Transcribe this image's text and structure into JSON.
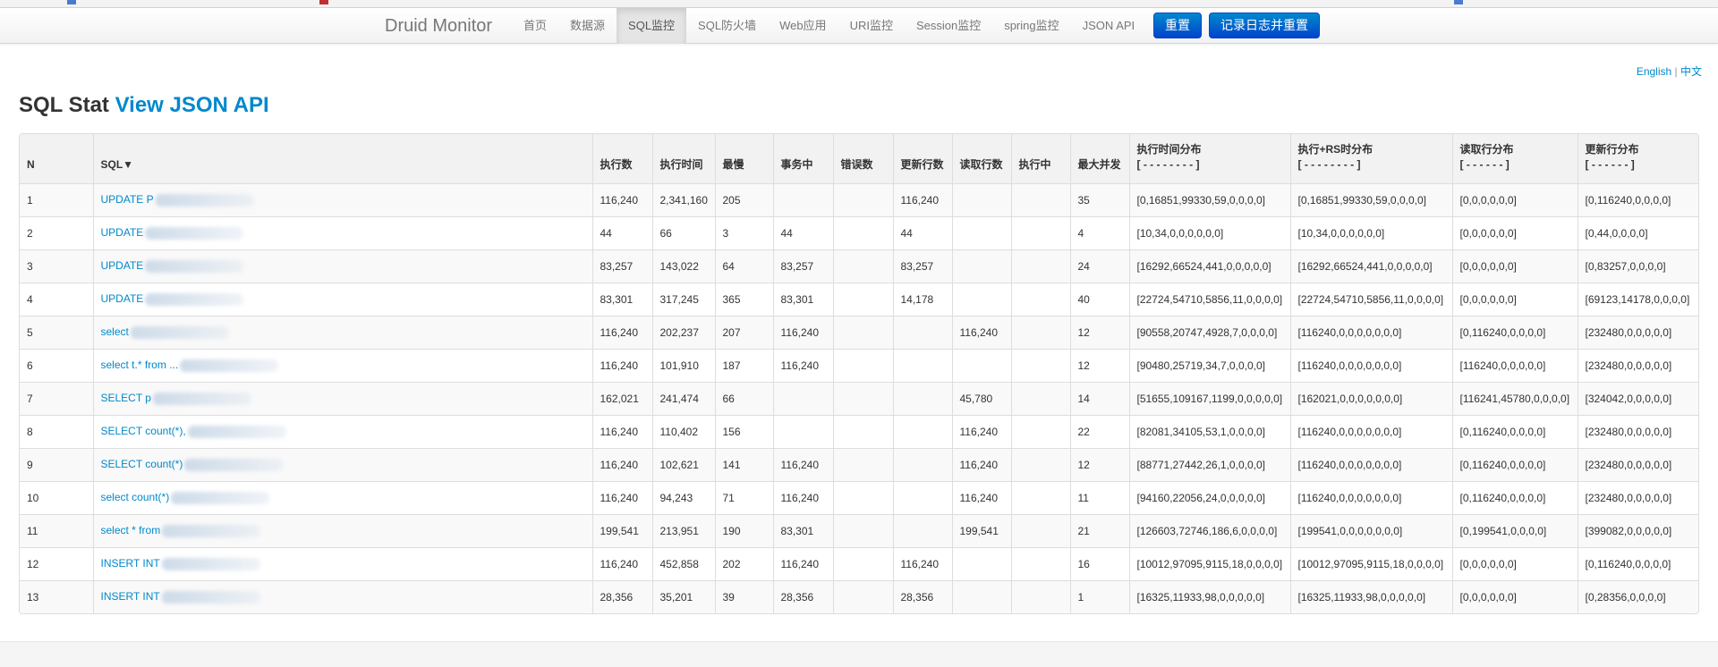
{
  "navbar": {
    "brand": "Druid Monitor",
    "items": [
      "首页",
      "数据源",
      "SQL监控",
      "SQL防火墙",
      "Web应用",
      "URI监控",
      "Session监控",
      "spring监控",
      "JSON API"
    ],
    "active_index": 2,
    "reset_button": "重置",
    "log_reset_button": "记录日志并重置"
  },
  "lang": {
    "english": "English",
    "separator": "|",
    "chinese": "中文"
  },
  "page": {
    "title": "SQL Stat",
    "json_link": "View JSON API"
  },
  "table": {
    "headers": {
      "n": "N",
      "sql": "SQL▼",
      "exec_count": "执行数",
      "exec_time": "执行时间",
      "slowest": "最慢",
      "in_txn": "事务中",
      "errors": "错误数",
      "update_rows": "更新行数",
      "fetch_rows": "读取行数",
      "running": "执行中",
      "max_concurrent": "最大并发",
      "exec_hist": "执行时间分布",
      "exec_hist_sub": "[ - - - - - - - - ]",
      "exec_rs_hist": "执行+RS时分布",
      "exec_rs_hist_sub": "[ - - - - - - - - ]",
      "fetch_hist": "读取行分布",
      "fetch_hist_sub": "[ - - - - - - ]",
      "update_hist": "更新行分布",
      "update_hist_sub": "[ - - - - - - ]"
    },
    "rows": [
      {
        "n": "1",
        "sql": "UPDATE P",
        "exec": "116,240",
        "time": "2,341,160",
        "slow": "205",
        "txn": "",
        "err": "",
        "upd": "116,240",
        "fetch": "",
        "run": "",
        "maxc": "35",
        "h1": "[0,16851,99330,59,0,0,0,0]",
        "h2": "[0,16851,99330,59,0,0,0,0]",
        "h3": "[0,0,0,0,0,0]",
        "h4": "[0,116240,0,0,0,0]"
      },
      {
        "n": "2",
        "sql": "UPDATE",
        "exec": "44",
        "time": "66",
        "slow": "3",
        "txn": "44",
        "err": "",
        "upd": "44",
        "fetch": "",
        "run": "",
        "maxc": "4",
        "h1": "[10,34,0,0,0,0,0,0]",
        "h2": "[10,34,0,0,0,0,0,0]",
        "h3": "[0,0,0,0,0,0]",
        "h4": "[0,44,0,0,0,0]"
      },
      {
        "n": "3",
        "sql": "UPDATE",
        "exec": "83,257",
        "time": "143,022",
        "slow": "64",
        "txn": "83,257",
        "err": "",
        "upd": "83,257",
        "fetch": "",
        "run": "",
        "maxc": "24",
        "h1": "[16292,66524,441,0,0,0,0,0]",
        "h2": "[16292,66524,441,0,0,0,0,0]",
        "h3": "[0,0,0,0,0,0]",
        "h4": "[0,83257,0,0,0,0]"
      },
      {
        "n": "4",
        "sql": "UPDATE",
        "exec": "83,301",
        "time": "317,245",
        "slow": "365",
        "txn": "83,301",
        "err": "",
        "upd": "14,178",
        "fetch": "",
        "run": "",
        "maxc": "40",
        "h1": "[22724,54710,5856,11,0,0,0,0]",
        "h2": "[22724,54710,5856,11,0,0,0,0]",
        "h3": "[0,0,0,0,0,0]",
        "h4": "[69123,14178,0,0,0,0]"
      },
      {
        "n": "5",
        "sql": "select",
        "exec": "116,240",
        "time": "202,237",
        "slow": "207",
        "txn": "116,240",
        "err": "",
        "upd": "",
        "fetch": "116,240",
        "run": "",
        "maxc": "12",
        "h1": "[90558,20747,4928,7,0,0,0,0]",
        "h2": "[116240,0,0,0,0,0,0,0]",
        "h3": "[0,116240,0,0,0,0]",
        "h4": "[232480,0,0,0,0,0]"
      },
      {
        "n": "6",
        "sql": "select t.* from ...",
        "exec": "116,240",
        "time": "101,910",
        "slow": "187",
        "txn": "116,240",
        "err": "",
        "upd": "",
        "fetch": "",
        "run": "",
        "maxc": "12",
        "h1": "[90480,25719,34,7,0,0,0,0]",
        "h2": "[116240,0,0,0,0,0,0,0]",
        "h3": "[116240,0,0,0,0,0]",
        "h4": "[232480,0,0,0,0,0]"
      },
      {
        "n": "7",
        "sql": "SELECT p",
        "exec": "162,021",
        "time": "241,474",
        "slow": "66",
        "txn": "",
        "err": "",
        "upd": "",
        "fetch": "45,780",
        "run": "",
        "maxc": "14",
        "h1": "[51655,109167,1199,0,0,0,0,0]",
        "h2": "[162021,0,0,0,0,0,0,0]",
        "h3": "[116241,45780,0,0,0,0]",
        "h4": "[324042,0,0,0,0,0]"
      },
      {
        "n": "8",
        "sql": "SELECT count(*),",
        "exec": "116,240",
        "time": "110,402",
        "slow": "156",
        "txn": "",
        "err": "",
        "upd": "",
        "fetch": "116,240",
        "run": "",
        "maxc": "22",
        "h1": "[82081,34105,53,1,0,0,0,0]",
        "h2": "[116240,0,0,0,0,0,0,0]",
        "h3": "[0,116240,0,0,0,0]",
        "h4": "[232480,0,0,0,0,0]"
      },
      {
        "n": "9",
        "sql": "SELECT count(*)",
        "exec": "116,240",
        "time": "102,621",
        "slow": "141",
        "txn": "116,240",
        "err": "",
        "upd": "",
        "fetch": "116,240",
        "run": "",
        "maxc": "12",
        "h1": "[88771,27442,26,1,0,0,0,0]",
        "h2": "[116240,0,0,0,0,0,0,0]",
        "h3": "[0,116240,0,0,0,0]",
        "h4": "[232480,0,0,0,0,0]"
      },
      {
        "n": "10",
        "sql": "select count(*)",
        "exec": "116,240",
        "time": "94,243",
        "slow": "71",
        "txn": "116,240",
        "err": "",
        "upd": "",
        "fetch": "116,240",
        "run": "",
        "maxc": "11",
        "h1": "[94160,22056,24,0,0,0,0,0]",
        "h2": "[116240,0,0,0,0,0,0,0]",
        "h3": "[0,116240,0,0,0,0]",
        "h4": "[232480,0,0,0,0,0]"
      },
      {
        "n": "11",
        "sql": "select * from",
        "exec": "199,541",
        "time": "213,951",
        "slow": "190",
        "txn": "83,301",
        "err": "",
        "upd": "",
        "fetch": "199,541",
        "run": "",
        "maxc": "21",
        "h1": "[126603,72746,186,6,0,0,0,0]",
        "h2": "[199541,0,0,0,0,0,0,0]",
        "h3": "[0,199541,0,0,0,0]",
        "h4": "[399082,0,0,0,0,0]"
      },
      {
        "n": "12",
        "sql": "INSERT INT",
        "exec": "116,240",
        "time": "452,858",
        "slow": "202",
        "txn": "116,240",
        "err": "",
        "upd": "116,240",
        "fetch": "",
        "run": "",
        "maxc": "16",
        "h1": "[10012,97095,9115,18,0,0,0,0]",
        "h2": "[10012,97095,9115,18,0,0,0,0]",
        "h3": "[0,0,0,0,0,0]",
        "h4": "[0,116240,0,0,0,0]"
      },
      {
        "n": "13",
        "sql": "INSERT INT",
        "exec": "28,356",
        "time": "35,201",
        "slow": "39",
        "txn": "28,356",
        "err": "",
        "upd": "28,356",
        "fetch": "",
        "run": "",
        "maxc": "1",
        "h1": "[16325,11933,98,0,0,0,0,0]",
        "h2": "[16325,11933,98,0,0,0,0,0]",
        "h3": "[0,0,0,0,0,0]",
        "h4": "[0,28356,0,0,0,0]"
      }
    ]
  },
  "colors": {
    "link": "#0088cc",
    "button": "#0044cc",
    "header_bg": "#f2f2f2",
    "stripe": "#f9f9f9"
  }
}
